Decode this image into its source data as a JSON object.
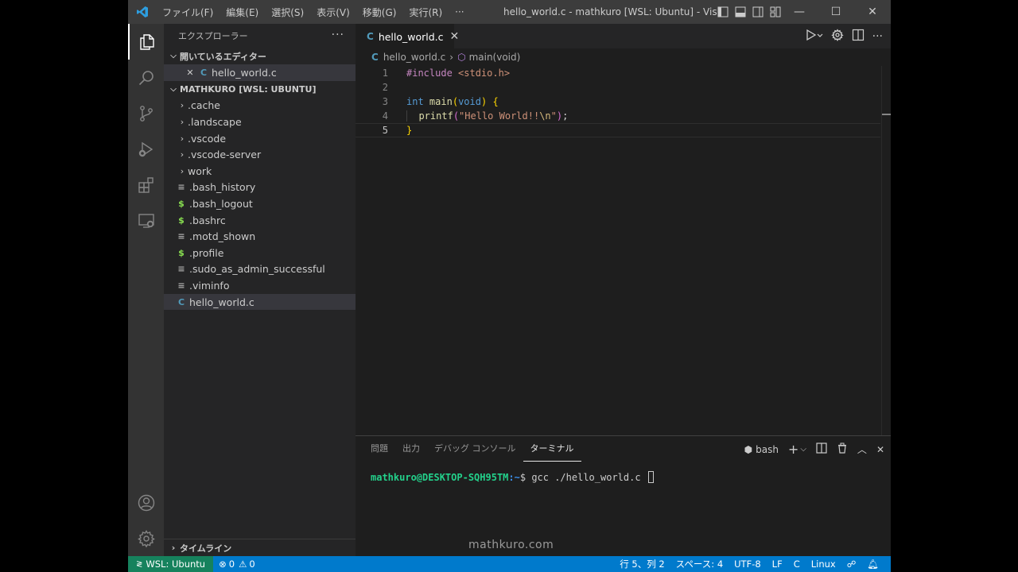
{
  "titlebar": {
    "menus": [
      "ファイル(F)",
      "編集(E)",
      "選択(S)",
      "表示(V)",
      "移動(G)",
      "実行(R)",
      "···"
    ],
    "title": "hello_world.c - mathkuro [WSL: Ubuntu] - Visual Studio Code",
    "minimize": "—",
    "maximize": "☐",
    "close": "✕"
  },
  "sidebar": {
    "header": "エクスプローラー",
    "more": "···",
    "open_editors_label": "開いているエディター",
    "open_editor_file": "hello_world.c",
    "workspace_label": "MATHKURO [WSL: UBUNTU]",
    "folders": [
      ".cache",
      ".landscape",
      ".vscode",
      ".vscode-server",
      "work"
    ],
    "files": [
      {
        "name": ".bash_history",
        "type": "txt"
      },
      {
        "name": ".bash_logout",
        "type": "sh"
      },
      {
        "name": ".bashrc",
        "type": "sh"
      },
      {
        "name": ".motd_shown",
        "type": "txt"
      },
      {
        "name": ".profile",
        "type": "sh"
      },
      {
        "name": ".sudo_as_admin_successful",
        "type": "txt"
      },
      {
        "name": ".viminfo",
        "type": "txt"
      },
      {
        "name": "hello_world.c",
        "type": "c"
      }
    ],
    "timeline_label": "タイムライン"
  },
  "editor": {
    "tab_label": "hello_world.c",
    "breadcrumb_file": "hello_world.c",
    "breadcrumb_symbol": "main(void)",
    "line_numbers": [
      "1",
      "2",
      "3",
      "4",
      "5"
    ],
    "code": {
      "l1_directive": "#include",
      "l1_header": "<stdio.h>",
      "l3_type": "int",
      "l3_fn": "main",
      "l3_param": "void",
      "l4_fn": "printf",
      "l4_str": "\"Hello World!!",
      "l4_esc": "\\n",
      "l4_str_end": "\""
    }
  },
  "panel": {
    "tabs": [
      "問題",
      "出力",
      "デバッグ コンソール",
      "ターミナル"
    ],
    "active_tab": "ターミナル",
    "shell": "bash",
    "terminal": {
      "prompt_user": "mathkuro@DESKTOP-SQH95TM",
      "prompt_path": ":~",
      "prompt_sign": "$",
      "command": "gcc ./hello_world.c"
    }
  },
  "statusbar": {
    "remote": "WSL: Ubuntu",
    "errors": "0",
    "warnings": "0",
    "position": "行 5、列 2",
    "spaces": "スペース: 4",
    "encoding": "UTF-8",
    "eol": "LF",
    "language": "C",
    "platform": "Linux"
  },
  "watermark": "mathkuro.com",
  "colors": {
    "accent": "#007acc",
    "remote": "#16825d",
    "c_icon": "#519aba",
    "shell_icon": "#89e051"
  }
}
